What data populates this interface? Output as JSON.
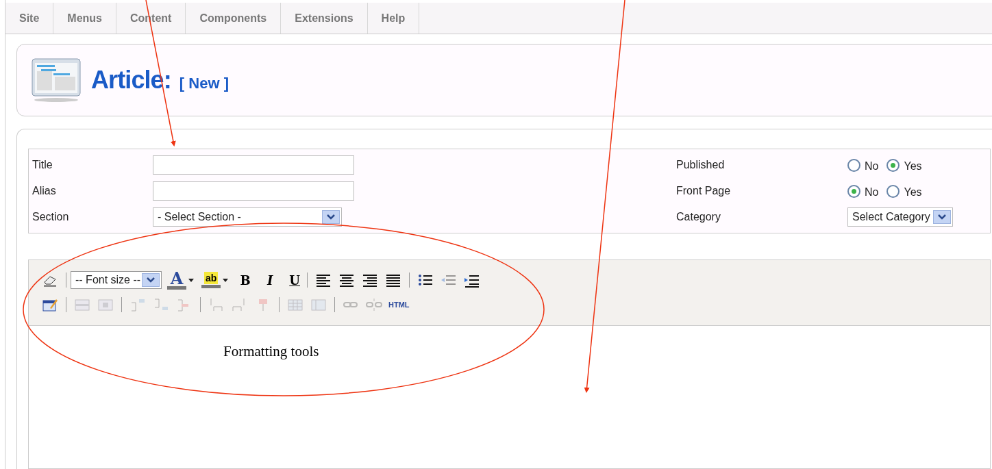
{
  "menu": [
    {
      "label": "Site"
    },
    {
      "label": "Menus"
    },
    {
      "label": "Content"
    },
    {
      "label": "Components"
    },
    {
      "label": "Extensions"
    },
    {
      "label": "Help"
    }
  ],
  "header": {
    "title": "Article:",
    "subtitle": "[ New ]"
  },
  "form_left": [
    {
      "label": "Title",
      "kind": "text"
    },
    {
      "label": "Alias",
      "kind": "text"
    },
    {
      "label": "Section",
      "kind": "select",
      "value": "- Select Section -"
    }
  ],
  "form_right": [
    {
      "label": "Published",
      "kind": "radio",
      "options": [
        {
          "label": "No",
          "selected": false
        },
        {
          "label": "Yes",
          "selected": true
        }
      ]
    },
    {
      "label": "Front Page",
      "kind": "radio",
      "options": [
        {
          "label": "No",
          "selected": true
        },
        {
          "label": "Yes",
          "selected": false
        }
      ]
    },
    {
      "label": "Category",
      "kind": "select",
      "value": "Select Category"
    }
  ],
  "editor": {
    "font_size": "-- Font size --",
    "font_color": "A",
    "highlight": "ab",
    "bold": "B",
    "italic": "I",
    "underline": "U",
    "html": "HTML"
  },
  "annotation": {
    "label": "Formatting tools"
  }
}
